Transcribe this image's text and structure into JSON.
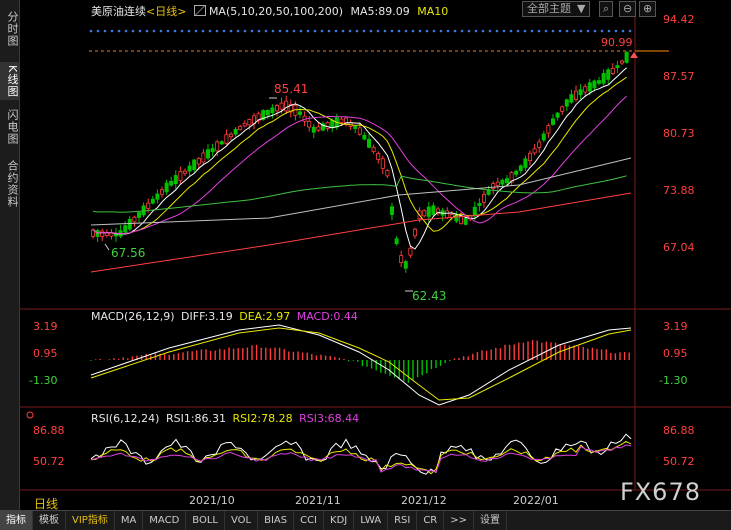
{
  "sidebar": {
    "tabs": [
      {
        "label": "分时图",
        "active": false
      },
      {
        "label": "K线图",
        "active": true
      },
      {
        "label": "闪电图",
        "active": false
      },
      {
        "label": "合约资料",
        "active": false
      }
    ]
  },
  "header": {
    "title": "美原油连续",
    "period": "<日线>",
    "ma_label": "MA(5,10,20,50,100,200)",
    "ma5_label": "MA5:89.09",
    "ma10_label": "MA10",
    "theme_button": "全部主题",
    "theme_arrow": "▼"
  },
  "price_panel": {
    "y_ticks": [
      "94.42",
      "87.57",
      "80.73",
      "73.88",
      "67.04"
    ],
    "y_values": [
      94.42,
      87.57,
      80.73,
      73.88,
      67.04
    ],
    "last_price_label": "90.99",
    "high_label": "85.41",
    "low_label": "62.43",
    "left_label": "67.56"
  },
  "macd_panel": {
    "title": "MACD(26,12,9)",
    "diff": "DIFF:3.19",
    "dea": "DEA:2.97",
    "macd": "MACD:0.44",
    "y_ticks": [
      "3.19",
      "0.95",
      "-1.30"
    ]
  },
  "rsi_panel": {
    "title": "RSI(6,12,24)",
    "rsi1": "RSI1:86.31",
    "rsi2": "RSI2:78.28",
    "rsi3": "RSI3:68.44",
    "y_ticks": [
      "86.88",
      "50.72"
    ]
  },
  "x_axis": {
    "period_label": "日线",
    "labels": [
      "2021/10",
      "2021/11",
      "2021/12",
      "2022/01"
    ]
  },
  "bottom_tabs": [
    "指标",
    "模板",
    "VIP指标",
    "MA",
    "MACD",
    "BOLL",
    "VOL",
    "BIAS",
    "CCI",
    "KDJ",
    "LWA",
    "RSI",
    "CR",
    ">>",
    "设置"
  ],
  "watermark": "FX678",
  "colors": {
    "up": "#ff3c3c",
    "down": "#00c000",
    "ma5": "#ffffff",
    "ma10": "#e8e800",
    "ma20": "#e040e0",
    "ma50": "#40c040",
    "ma100": "#c0c0c0",
    "ma200": "#ff4040"
  },
  "chart_data": [
    {
      "type": "candlestick",
      "title": "美原油连续 <日线>",
      "ylim": [
        62.43,
        94.42
      ],
      "highest": 85.41,
      "lowest": 62.43,
      "last": 90.99,
      "x_labels": [
        "2021/10",
        "2021/11",
        "2021/12",
        "2022/01"
      ],
      "series": [
        {
          "name": "MA5",
          "last": 89.09
        }
      ]
    },
    {
      "type": "line",
      "title": "MACD(26,12,9)",
      "series": [
        {
          "name": "DIFF",
          "last": 3.19
        },
        {
          "name": "DEA",
          "last": 2.97
        },
        {
          "name": "MACD",
          "last": 0.44
        }
      ],
      "y_ticks": [
        3.19,
        0.95,
        -1.3
      ]
    },
    {
      "type": "line",
      "title": "RSI(6,12,24)",
      "series": [
        {
          "name": "RSI1",
          "last": 86.31
        },
        {
          "name": "RSI2",
          "last": 78.28
        },
        {
          "name": "RSI3",
          "last": 68.44
        }
      ],
      "y_ticks": [
        86.88,
        50.72
      ]
    }
  ]
}
